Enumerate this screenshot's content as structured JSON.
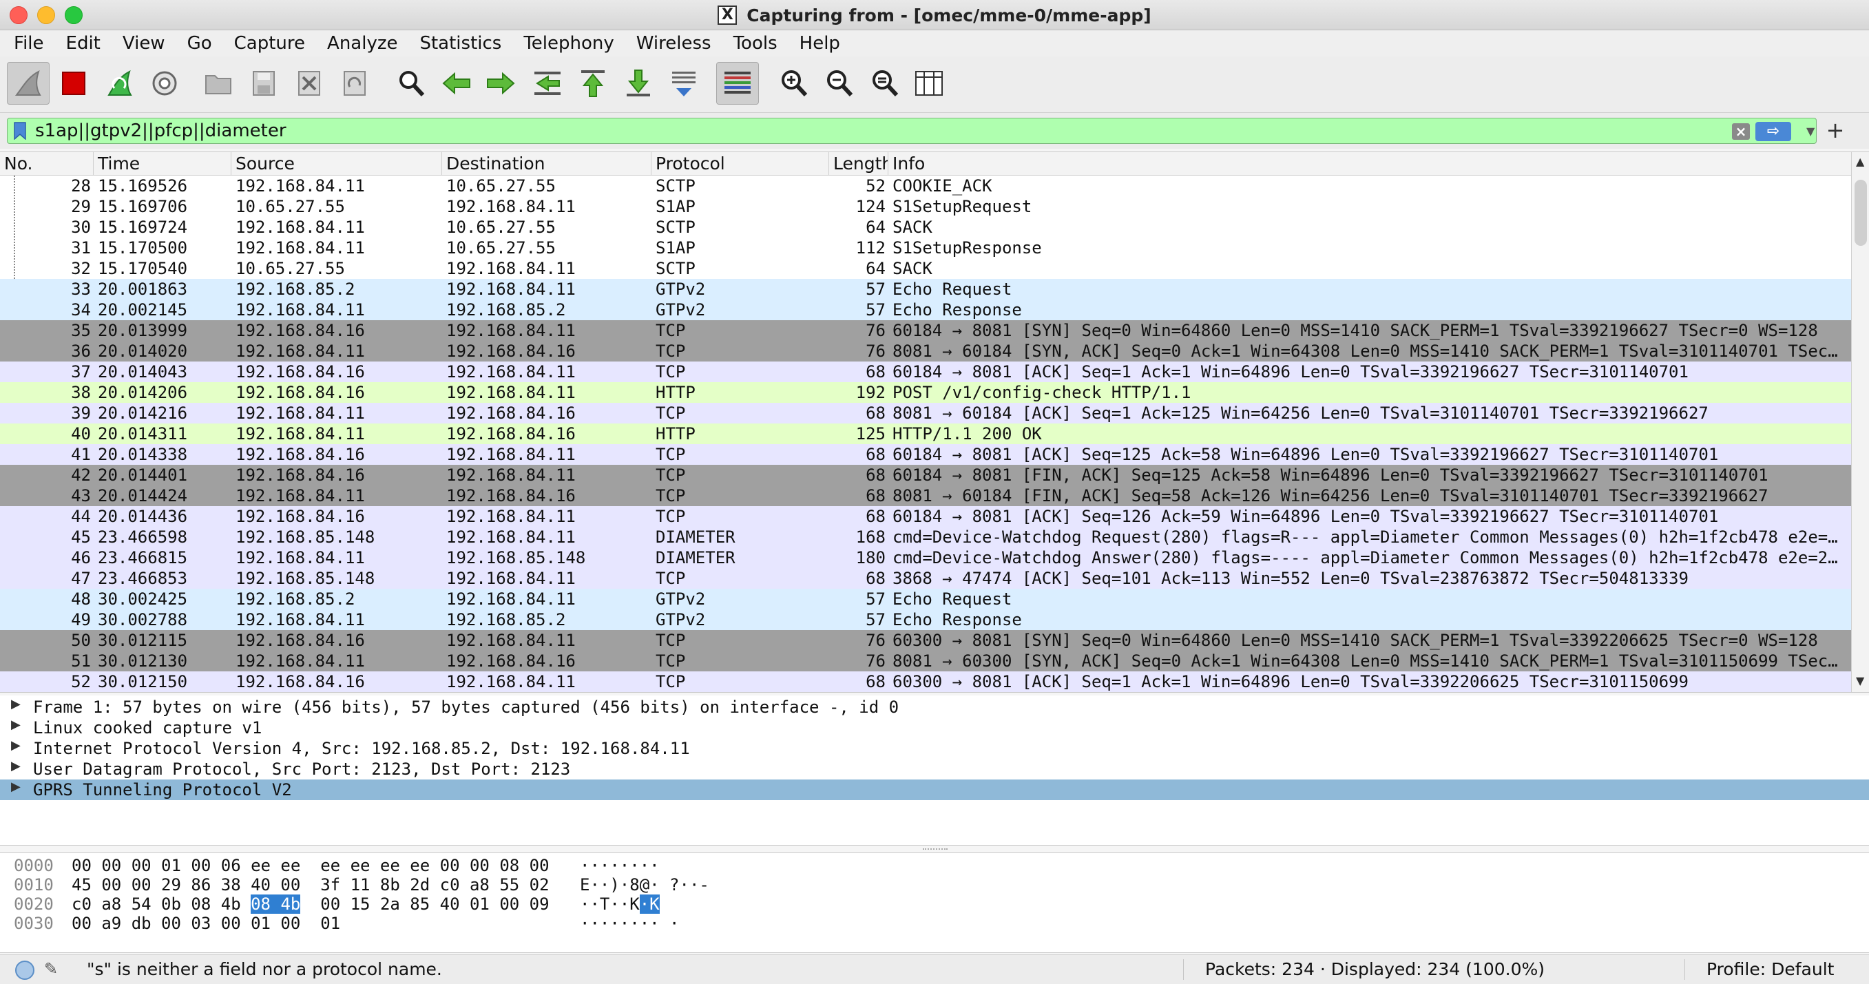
{
  "window": {
    "title": "Capturing from - [omec/mme-0/mme-app]"
  },
  "menu": [
    "File",
    "Edit",
    "View",
    "Go",
    "Capture",
    "Analyze",
    "Statistics",
    "Telephony",
    "Wireless",
    "Tools",
    "Help"
  ],
  "toolbar": {
    "icons": [
      "shark-fin-start-icon",
      "stop-capture-icon",
      "restart-capture-icon",
      "capture-options-icon",
      "open-file-icon",
      "save-file-icon",
      "close-file-icon",
      "reload-file-icon",
      "find-packet-icon",
      "go-back-icon",
      "go-forward-icon",
      "go-to-packet-icon",
      "go-first-icon",
      "go-last-icon",
      "autoscroll-icon",
      "colorize-icon",
      "zoom-in-icon",
      "zoom-out-icon",
      "zoom-normal-icon",
      "resize-columns-icon"
    ]
  },
  "filter": {
    "value": "s1ap||gtpv2||pfcp||diameter"
  },
  "packet_list": {
    "columns": [
      "No.",
      "Time",
      "Source",
      "Destination",
      "Protocol",
      "Length",
      "Info"
    ],
    "rows": [
      {
        "no": "28",
        "time": "15.169526",
        "src": "192.168.84.11",
        "dst": "10.65.27.55",
        "proto": "SCTP",
        "len": "52",
        "info": "COOKIE_ACK",
        "bg": "#ffffff"
      },
      {
        "no": "29",
        "time": "15.169706",
        "src": "10.65.27.55",
        "dst": "192.168.84.11",
        "proto": "S1AP",
        "len": "124",
        "info": "S1SetupRequest",
        "bg": "#ffffff"
      },
      {
        "no": "30",
        "time": "15.169724",
        "src": "192.168.84.11",
        "dst": "10.65.27.55",
        "proto": "SCTP",
        "len": "64",
        "info": "SACK",
        "bg": "#ffffff"
      },
      {
        "no": "31",
        "time": "15.170500",
        "src": "192.168.84.11",
        "dst": "10.65.27.55",
        "proto": "S1AP",
        "len": "112",
        "info": "S1SetupResponse",
        "bg": "#ffffff"
      },
      {
        "no": "32",
        "time": "15.170540",
        "src": "10.65.27.55",
        "dst": "192.168.84.11",
        "proto": "SCTP",
        "len": "64",
        "info": "SACK",
        "bg": "#ffffff"
      },
      {
        "no": "33",
        "time": "20.001863",
        "src": "192.168.85.2",
        "dst": "192.168.84.11",
        "proto": "GTPv2",
        "len": "57",
        "info": "Echo Request",
        "bg": "#daeeff"
      },
      {
        "no": "34",
        "time": "20.002145",
        "src": "192.168.84.11",
        "dst": "192.168.85.2",
        "proto": "GTPv2",
        "len": "57",
        "info": "Echo Response",
        "bg": "#daeeff"
      },
      {
        "no": "35",
        "time": "20.013999",
        "src": "192.168.84.16",
        "dst": "192.168.84.11",
        "proto": "TCP",
        "len": "76",
        "info": "60184 → 8081 [SYN] Seq=0 Win=64860 Len=0 MSS=1410 SACK_PERM=1 TSval=3392196627 TSecr=0 WS=128",
        "bg": "#a0a0a0"
      },
      {
        "no": "36",
        "time": "20.014020",
        "src": "192.168.84.11",
        "dst": "192.168.84.16",
        "proto": "TCP",
        "len": "76",
        "info": "8081 → 60184 [SYN, ACK] Seq=0 Ack=1 Win=64308 Len=0 MSS=1410 SACK_PERM=1 TSval=3101140701 TSec…",
        "bg": "#a0a0a0"
      },
      {
        "no": "37",
        "time": "20.014043",
        "src": "192.168.84.16",
        "dst": "192.168.84.11",
        "proto": "TCP",
        "len": "68",
        "info": "60184 → 8081 [ACK] Seq=1 Ack=1 Win=64896 Len=0 TSval=3392196627 TSecr=3101140701",
        "bg": "#e7e6ff"
      },
      {
        "no": "38",
        "time": "20.014206",
        "src": "192.168.84.16",
        "dst": "192.168.84.11",
        "proto": "HTTP",
        "len": "192",
        "info": "POST /v1/config-check HTTP/1.1",
        "bg": "#e4ffc7"
      },
      {
        "no": "39",
        "time": "20.014216",
        "src": "192.168.84.11",
        "dst": "192.168.84.16",
        "proto": "TCP",
        "len": "68",
        "info": "8081 → 60184 [ACK] Seq=1 Ack=125 Win=64256 Len=0 TSval=3101140701 TSecr=3392196627",
        "bg": "#e7e6ff"
      },
      {
        "no": "40",
        "time": "20.014311",
        "src": "192.168.84.11",
        "dst": "192.168.84.16",
        "proto": "HTTP",
        "len": "125",
        "info": "HTTP/1.1 200 OK",
        "bg": "#e4ffc7"
      },
      {
        "no": "41",
        "time": "20.014338",
        "src": "192.168.84.16",
        "dst": "192.168.84.11",
        "proto": "TCP",
        "len": "68",
        "info": "60184 → 8081 [ACK] Seq=125 Ack=58 Win=64896 Len=0 TSval=3392196627 TSecr=3101140701",
        "bg": "#e7e6ff"
      },
      {
        "no": "42",
        "time": "20.014401",
        "src": "192.168.84.16",
        "dst": "192.168.84.11",
        "proto": "TCP",
        "len": "68",
        "info": "60184 → 8081 [FIN, ACK] Seq=125 Ack=58 Win=64896 Len=0 TSval=3392196627 TSecr=3101140701",
        "bg": "#a0a0a0"
      },
      {
        "no": "43",
        "time": "20.014424",
        "src": "192.168.84.11",
        "dst": "192.168.84.16",
        "proto": "TCP",
        "len": "68",
        "info": "8081 → 60184 [FIN, ACK] Seq=58 Ack=126 Win=64256 Len=0 TSval=3101140701 TSecr=3392196627",
        "bg": "#a0a0a0"
      },
      {
        "no": "44",
        "time": "20.014436",
        "src": "192.168.84.16",
        "dst": "192.168.84.11",
        "proto": "TCP",
        "len": "68",
        "info": "60184 → 8081 [ACK] Seq=126 Ack=59 Win=64896 Len=0 TSval=3392196627 TSecr=3101140701",
        "bg": "#e7e6ff"
      },
      {
        "no": "45",
        "time": "23.466598",
        "src": "192.168.85.148",
        "dst": "192.168.84.11",
        "proto": "DIAMETER",
        "len": "168",
        "info": "cmd=Device-Watchdog Request(280) flags=R--- appl=Diameter Common Messages(0) h2h=1f2cb478 e2e=…",
        "bg": "#e7e6ff"
      },
      {
        "no": "46",
        "time": "23.466815",
        "src": "192.168.84.11",
        "dst": "192.168.85.148",
        "proto": "DIAMETER",
        "len": "180",
        "info": "cmd=Device-Watchdog Answer(280) flags=---- appl=Diameter Common Messages(0) h2h=1f2cb478 e2e=2…",
        "bg": "#e7e6ff"
      },
      {
        "no": "47",
        "time": "23.466853",
        "src": "192.168.85.148",
        "dst": "192.168.84.11",
        "proto": "TCP",
        "len": "68",
        "info": "3868 → 47474 [ACK] Seq=101 Ack=113 Win=552 Len=0 TSval=238763872 TSecr=504813339",
        "bg": "#e7e6ff"
      },
      {
        "no": "48",
        "time": "30.002425",
        "src": "192.168.85.2",
        "dst": "192.168.84.11",
        "proto": "GTPv2",
        "len": "57",
        "info": "Echo Request",
        "bg": "#daeeff"
      },
      {
        "no": "49",
        "time": "30.002788",
        "src": "192.168.84.11",
        "dst": "192.168.85.2",
        "proto": "GTPv2",
        "len": "57",
        "info": "Echo Response",
        "bg": "#daeeff"
      },
      {
        "no": "50",
        "time": "30.012115",
        "src": "192.168.84.16",
        "dst": "192.168.84.11",
        "proto": "TCP",
        "len": "76",
        "info": "60300 → 8081 [SYN] Seq=0 Win=64860 Len=0 MSS=1410 SACK_PERM=1 TSval=3392206625 TSecr=0 WS=128",
        "bg": "#a0a0a0"
      },
      {
        "no": "51",
        "time": "30.012130",
        "src": "192.168.84.11",
        "dst": "192.168.84.16",
        "proto": "TCP",
        "len": "76",
        "info": "8081 → 60300 [SYN, ACK] Seq=0 Ack=1 Win=64308 Len=0 MSS=1410 SACK_PERM=1 TSval=3101150699 TSec…",
        "bg": "#a0a0a0"
      },
      {
        "no": "52",
        "time": "30.012150",
        "src": "192.168.84.16",
        "dst": "192.168.84.11",
        "proto": "TCP",
        "len": "68",
        "info": "60300 → 8081 [ACK] Seq=1 Ack=1 Win=64896 Len=0 TSval=3392206625 TSecr=3101150699",
        "bg": "#e7e6ff"
      }
    ]
  },
  "details": [
    {
      "text": "Frame 1: 57 bytes on wire (456 bits), 57 bytes captured (456 bits) on interface -, id 0",
      "selected": false
    },
    {
      "text": "Linux cooked capture v1",
      "selected": false
    },
    {
      "text": "Internet Protocol Version 4, Src: 192.168.85.2, Dst: 192.168.84.11",
      "selected": false
    },
    {
      "text": "User Datagram Protocol, Src Port: 2123, Dst Port: 2123",
      "selected": false
    },
    {
      "text": "GPRS Tunneling Protocol V2",
      "selected": true
    }
  ],
  "bytes": [
    {
      "offset": "0000",
      "hex_a": "00 00 00 01 00 06 ee ee  ee ee ee ee 00 00 08 00",
      "hex_hl": "",
      "hex_b": "",
      "ascii_a": "········",
      "ascii_hl": "",
      "ascii_b": ""
    },
    {
      "offset": "0010",
      "hex_a": "45 00 00 29 86 38 40 00  3f 11 8b 2d c0 a8 55 02",
      "hex_hl": "",
      "hex_b": "",
      "ascii_a": "E··)·8@· ?··-",
      "ascii_hl": "",
      "ascii_b": ""
    },
    {
      "offset": "0020",
      "hex_a": "c0 a8 54 0b 08 4b ",
      "hex_hl": "08 4b",
      "hex_b": "  00 15 2a 85 40 01 00 09",
      "ascii_a": "··T··K",
      "ascii_hl": "·K",
      "ascii_b": ""
    },
    {
      "offset": "0030",
      "hex_a": "00 a9 db 00 03 00 01 00  01",
      "hex_hl": "",
      "hex_b": "",
      "ascii_a": "········ ·",
      "ascii_hl": "",
      "ascii_b": ""
    }
  ],
  "status": {
    "message": "\"s\" is neither a field nor a protocol name.",
    "packets": "Packets: 234 · Displayed: 234 (100.0%)",
    "profile": "Profile: Default"
  }
}
